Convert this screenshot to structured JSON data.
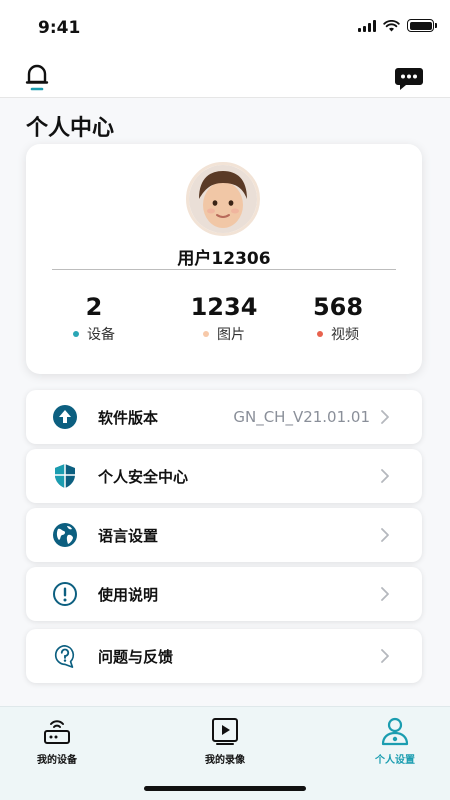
{
  "status": {
    "time": "9:41"
  },
  "page": {
    "title": "个人中心"
  },
  "profile": {
    "username": "用户12306",
    "stats": [
      {
        "value": "2",
        "label": "设备",
        "dot_color": "#2aa6b5"
      },
      {
        "value": "1234",
        "label": "图片",
        "dot_color": "#f7c9a9"
      },
      {
        "value": "568",
        "label": "视频",
        "dot_color": "#e8624e"
      }
    ]
  },
  "menu": {
    "items": [
      {
        "label": "软件版本",
        "value": "GN_CH_V21.01.01",
        "icon": "upload-circle-icon"
      },
      {
        "label": "个人安全中心",
        "value": "",
        "icon": "shield-icon"
      },
      {
        "label": "语言设置",
        "value": "",
        "icon": "globe-icon"
      },
      {
        "label": "使用说明",
        "value": "",
        "icon": "info-circle-icon"
      },
      {
        "label": "问题与反馈",
        "value": "",
        "icon": "question-bubble-icon"
      }
    ]
  },
  "tabs": [
    {
      "label": "我的设备",
      "icon": "router-icon",
      "active": false
    },
    {
      "label": "我的录像",
      "icon": "video-player-icon",
      "active": false
    },
    {
      "label": "个人设置",
      "icon": "user-icon",
      "active": true
    }
  ],
  "colors": {
    "accent": "#1b9db0",
    "icon_dark": "#0c5f80",
    "background": "#f7f8fa"
  }
}
